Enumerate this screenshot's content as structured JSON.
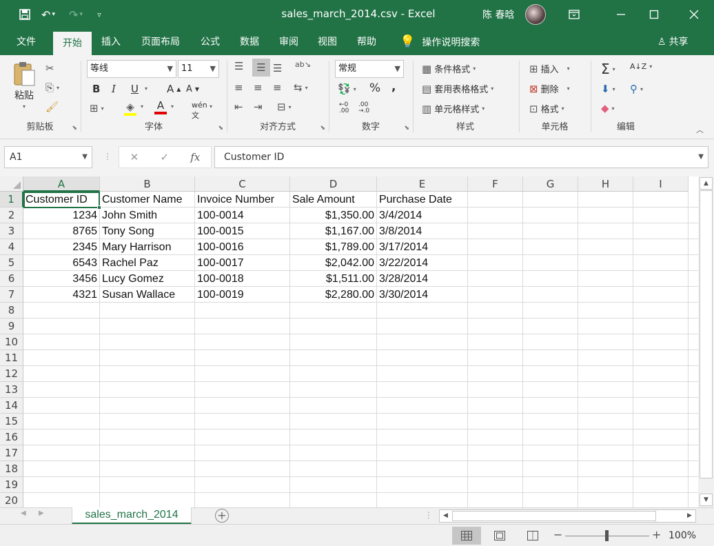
{
  "window": {
    "title": "sales_march_2014.csv  -  Excel",
    "user": "陈 春晗",
    "colors": {
      "brand": "#217346",
      "ribbon_bg": "#f3f3f3"
    }
  },
  "quick_access": {
    "save_icon": "save-icon",
    "undo_icon": "undo-icon",
    "redo_icon": "redo-icon",
    "customize_icon": "customize-icon"
  },
  "tabs": [
    "文件",
    "开始",
    "插入",
    "页面布局",
    "公式",
    "数据",
    "审阅",
    "视图",
    "帮助"
  ],
  "active_tab": "开始",
  "tell_me": "操作说明搜索",
  "share": "共享",
  "ribbon": {
    "clipboard": {
      "label": "剪贴板",
      "paste": "粘贴"
    },
    "font": {
      "label": "字体",
      "name": "等线",
      "size": "11",
      "bold": "B",
      "italic": "I",
      "underline": "U"
    },
    "alignment": {
      "label": "对齐方式"
    },
    "number": {
      "label": "数字",
      "format": "常规",
      "percent": "%",
      "comma": ","
    },
    "styles": {
      "label": "样式",
      "conditional": "条件格式",
      "table": "套用表格格式",
      "cell_styles": "单元格样式"
    },
    "cells": {
      "label": "单元格",
      "insert": "插入",
      "delete": "删除",
      "format": "格式"
    },
    "editing": {
      "label": "编辑"
    }
  },
  "formula_bar": {
    "name_box": "A1",
    "fx": "fx",
    "content": "Customer ID"
  },
  "columns": [
    "A",
    "B",
    "C",
    "D",
    "E",
    "F",
    "G",
    "H",
    "I"
  ],
  "rows": [
    "1",
    "2",
    "3",
    "4",
    "5",
    "6",
    "7",
    "8",
    "9",
    "10",
    "11",
    "12",
    "13",
    "14",
    "15",
    "16",
    "17",
    "18",
    "19",
    "20"
  ],
  "table": {
    "headers": [
      "Customer ID",
      "Customer Name",
      "Invoice Number",
      "Sale Amount",
      "Purchase Date"
    ],
    "data": [
      [
        "1234",
        "John Smith",
        "100-0014",
        "$1,350.00",
        "3/4/2014"
      ],
      [
        "8765",
        "Tony Song",
        "100-0015",
        "$1,167.00",
        "3/8/2014"
      ],
      [
        "2345",
        "Mary Harrison",
        "100-0016",
        "$1,789.00",
        "3/17/2014"
      ],
      [
        "6543",
        "Rachel Paz",
        "100-0017",
        "$2,042.00",
        "3/22/2014"
      ],
      [
        "3456",
        "Lucy Gomez",
        "100-0018",
        "$1,511.00",
        "3/28/2014"
      ],
      [
        "4321",
        "Susan Wallace",
        "100-0019",
        "$2,280.00",
        "3/30/2014"
      ]
    ]
  },
  "selected_cell": "A1",
  "sheet_tab": "sales_march_2014",
  "status": {
    "zoom": "100%"
  }
}
